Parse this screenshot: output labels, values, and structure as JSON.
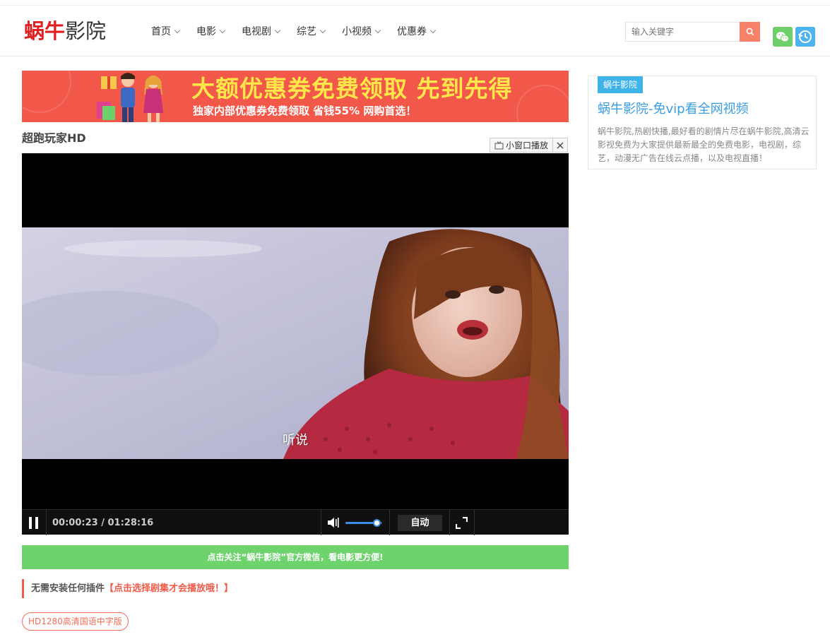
{
  "header": {
    "logo_part1": "蜗牛",
    "logo_part2": "影院",
    "nav": [
      {
        "label": "首页"
      },
      {
        "label": "电影"
      },
      {
        "label": "电视剧"
      },
      {
        "label": "综艺"
      },
      {
        "label": "小视频"
      },
      {
        "label": "优惠券"
      }
    ],
    "search_placeholder": "输入关键字",
    "icons": [
      "search-icon",
      "wechat-icon",
      "history-icon"
    ]
  },
  "banner": {
    "headline": "大额优惠券免费领取 先到先得",
    "subline": "独家内部优惠券免费领取 省钱55% 网购首选！"
  },
  "video": {
    "title": "超跑玩家HD",
    "mini_window_label": "小窗口播放",
    "subtitle": "听说",
    "current_time": "00:00:23",
    "duration": "01:28:16",
    "volume_level": 0.85,
    "quality_label": "自动"
  },
  "follow_bar": "点击关注“蜗牛影院”官方微信，看电影更方便!",
  "notice": {
    "plain": "无需安装任何插件",
    "highlight": "【点击选择剧集才会播放哦！】"
  },
  "episodes": [
    "HD1280高清国语中字版"
  ],
  "sidebar": {
    "tag": "蜗牛影院",
    "title": "蜗牛影院-免vip看全网视频",
    "description": "蜗牛影院,热剧快播,最好看的剧情片尽在蜗牛影院,高清云影视免费为大家提供最新最全的免费电影，电视剧，综艺，动漫无广告在线云点播，以及电视直播！"
  },
  "colors": {
    "brand_red": "#e02020",
    "search_button": "#f48168",
    "wechat_green": "#6fcf6a",
    "history_blue": "#4bb3f0",
    "banner_bg": "#f2584a",
    "follow_green": "#6ed36d",
    "sidebar_blue": "#3db3ea"
  }
}
